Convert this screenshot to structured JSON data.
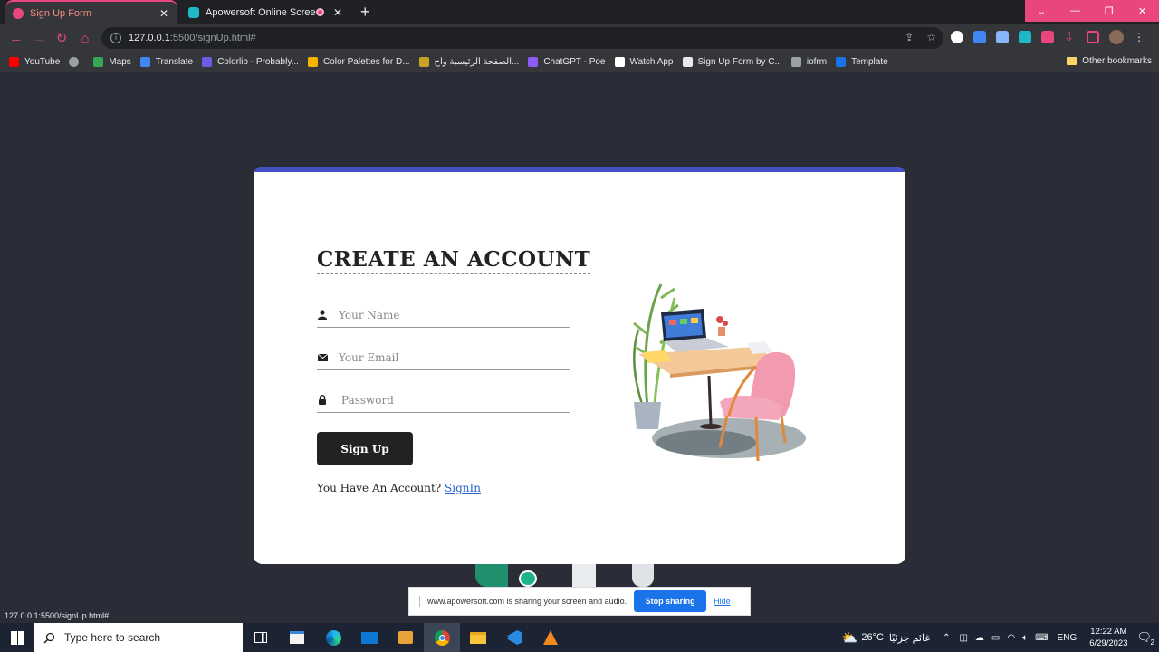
{
  "browser": {
    "tabs": [
      {
        "title": "Sign Up Form",
        "active": true
      },
      {
        "title": "Apowersoft Online Screen Re",
        "active": false
      }
    ],
    "url_host": "127.0.0.1",
    "url_rest": ":5500/signUp.html#",
    "bookmarks": [
      {
        "label": "YouTube",
        "color": "#ff0000"
      },
      {
        "label": "",
        "color": "#9aa0a6"
      },
      {
        "label": "Maps",
        "color": "#34a853"
      },
      {
        "label": "Translate",
        "color": "#4285f4"
      },
      {
        "label": "Colorlib - Probably...",
        "color": "#6b5ce7"
      },
      {
        "label": "Color Palettes for D...",
        "color": "#f4b400"
      },
      {
        "label": "الصفحة الرئيسية واح...",
        "color": "#c9a227"
      },
      {
        "label": "ChatGPT - Poe",
        "color": "#8a5cf5"
      },
      {
        "label": "Watch App",
        "color": "#ffffff"
      },
      {
        "label": "Sign Up Form by C...",
        "color": "#e8eaed"
      },
      {
        "label": "iofrm",
        "color": "#9aa0a6"
      },
      {
        "label": "Template",
        "color": "#1a73e8"
      }
    ],
    "other_bookmarks": "Other bookmarks",
    "status_url": "127.0.0.1:5500/signUp.html#"
  },
  "form": {
    "title": "CREATE AN ACCOUNT",
    "name_placeholder": "Your Name",
    "email_placeholder": "Your Email",
    "password_placeholder": "Password",
    "submit_label": "Sign Up",
    "account_prompt": "You Have An Account?",
    "signin_link": "SignIn"
  },
  "sharebar": {
    "message": "www.apowersoft.com is sharing your screen and audio.",
    "stop_label": "Stop sharing",
    "hide_label": "Hide"
  },
  "taskbar": {
    "search_placeholder": "Type here to search",
    "weather_temp": "26°C",
    "weather_text": "غائم جزئيًا",
    "language": "ENG",
    "time": "12:22 AM",
    "date": "6/29/2023",
    "notification_count": "2"
  },
  "colors": {
    "accent": "#4350c6",
    "page_bg": "#2a2c38",
    "chrome_accent": "#e8467c",
    "button_bg": "#222222",
    "link": "#2a63d0"
  }
}
